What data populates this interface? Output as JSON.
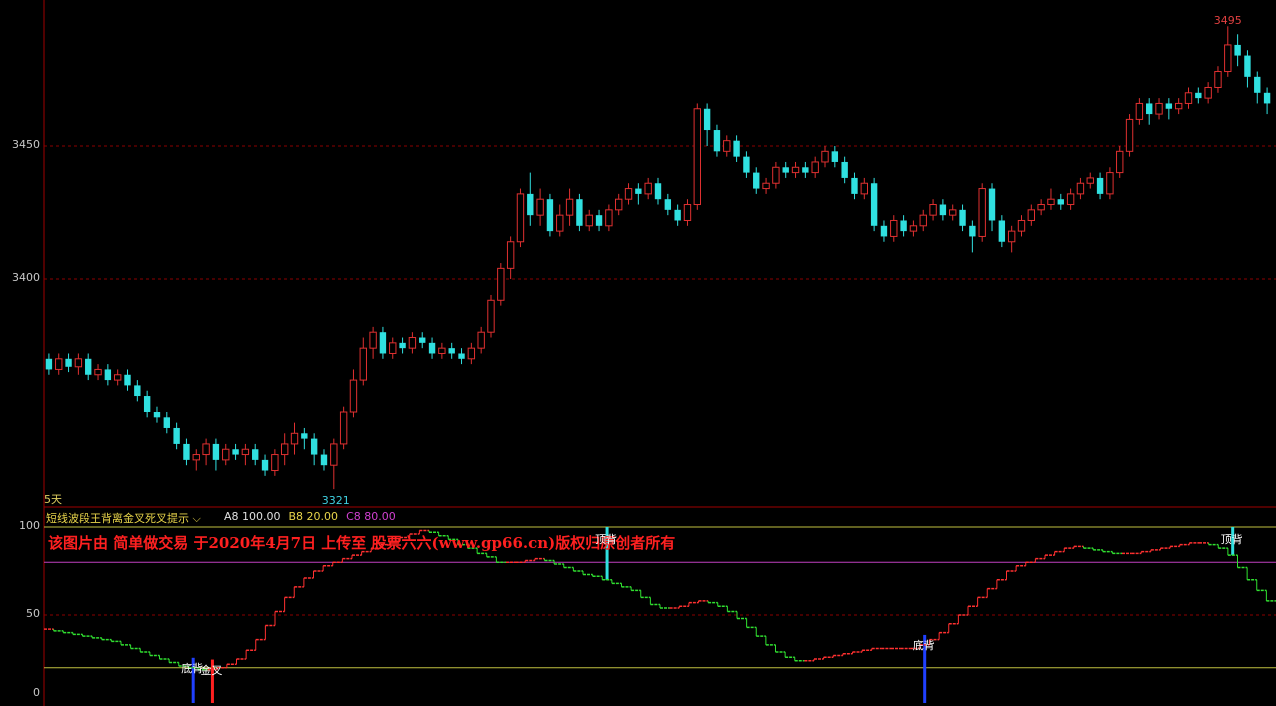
{
  "period_label": "5天",
  "indicator": {
    "title": "短线波段王背离金叉死叉提示",
    "dropdown_icon": "chevron-down-icon",
    "params": [
      {
        "name": "A8",
        "value": "100.00",
        "color": "#e0e0e0"
      },
      {
        "name": "B8",
        "value": "20.00",
        "color": "#e8d44a"
      },
      {
        "name": "C8",
        "value": "80.00",
        "color": "#d040d0"
      }
    ]
  },
  "watermark": "该图片由 简单做交易 于2020年4月7日 上传至 股票六六(www.gp66.cn)版权归原创者所有",
  "colors": {
    "up": "#e03030",
    "down": "#30e0e0",
    "grid": "#8b0000",
    "osc_up": "#ff3030",
    "osc_down": "#30e030"
  },
  "chart_data": [
    {
      "type": "candlestick",
      "y_ticks": [
        "3450",
        "3400"
      ],
      "ylim": [
        3321,
        3495
      ],
      "max_label": "3495",
      "min_label": "3321",
      "candles": [
        [
          3370,
          3366,
          3372,
          3364
        ],
        [
          3366,
          3370,
          3372,
          3364
        ],
        [
          3370,
          3367,
          3372,
          3365
        ],
        [
          3367,
          3370,
          3372,
          3364
        ],
        [
          3370,
          3364,
          3372,
          3362
        ],
        [
          3364,
          3366,
          3368,
          3362
        ],
        [
          3366,
          3362,
          3368,
          3360
        ],
        [
          3362,
          3364,
          3366,
          3360
        ],
        [
          3364,
          3360,
          3366,
          3358
        ],
        [
          3360,
          3356,
          3362,
          3354
        ],
        [
          3356,
          3350,
          3358,
          3348
        ],
        [
          3350,
          3348,
          3352,
          3346
        ],
        [
          3348,
          3344,
          3350,
          3342
        ],
        [
          3344,
          3338,
          3346,
          3336
        ],
        [
          3338,
          3332,
          3340,
          3330
        ],
        [
          3332,
          3334,
          3336,
          3328
        ],
        [
          3334,
          3338,
          3340,
          3330
        ],
        [
          3338,
          3332,
          3340,
          3328
        ],
        [
          3332,
          3336,
          3338,
          3330
        ],
        [
          3336,
          3334,
          3338,
          3332
        ],
        [
          3334,
          3336,
          3338,
          3330
        ],
        [
          3336,
          3332,
          3338,
          3330
        ],
        [
          3332,
          3328,
          3334,
          3326
        ],
        [
          3328,
          3334,
          3336,
          3326
        ],
        [
          3334,
          3338,
          3342,
          3330
        ],
        [
          3338,
          3342,
          3346,
          3334
        ],
        [
          3342,
          3340,
          3344,
          3336
        ],
        [
          3340,
          3334,
          3342,
          3330
        ],
        [
          3334,
          3330,
          3336,
          3328
        ],
        [
          3330,
          3338,
          3340,
          3321
        ],
        [
          3338,
          3350,
          3352,
          3336
        ],
        [
          3350,
          3362,
          3366,
          3348
        ],
        [
          3362,
          3374,
          3378,
          3360
        ],
        [
          3374,
          3380,
          3382,
          3370
        ],
        [
          3380,
          3372,
          3382,
          3370
        ],
        [
          3372,
          3376,
          3378,
          3370
        ],
        [
          3376,
          3374,
          3378,
          3372
        ],
        [
          3374,
          3378,
          3380,
          3372
        ],
        [
          3378,
          3376,
          3380,
          3374
        ],
        [
          3376,
          3372,
          3378,
          3370
        ],
        [
          3372,
          3374,
          3376,
          3370
        ],
        [
          3374,
          3372,
          3376,
          3370
        ],
        [
          3372,
          3370,
          3374,
          3368
        ],
        [
          3370,
          3374,
          3376,
          3368
        ],
        [
          3374,
          3380,
          3382,
          3372
        ],
        [
          3380,
          3392,
          3394,
          3378
        ],
        [
          3392,
          3404,
          3406,
          3390
        ],
        [
          3404,
          3414,
          3416,
          3400
        ],
        [
          3414,
          3432,
          3434,
          3412
        ],
        [
          3432,
          3424,
          3440,
          3420
        ],
        [
          3424,
          3430,
          3434,
          3420
        ],
        [
          3430,
          3418,
          3432,
          3416
        ],
        [
          3418,
          3424,
          3428,
          3416
        ],
        [
          3424,
          3430,
          3434,
          3420
        ],
        [
          3430,
          3420,
          3432,
          3418
        ],
        [
          3420,
          3424,
          3426,
          3418
        ],
        [
          3424,
          3420,
          3426,
          3418
        ],
        [
          3420,
          3426,
          3428,
          3418
        ],
        [
          3426,
          3430,
          3432,
          3424
        ],
        [
          3430,
          3434,
          3436,
          3428
        ],
        [
          3434,
          3432,
          3436,
          3428
        ],
        [
          3432,
          3436,
          3438,
          3430
        ],
        [
          3436,
          3430,
          3438,
          3428
        ],
        [
          3430,
          3426,
          3432,
          3424
        ],
        [
          3426,
          3422,
          3428,
          3420
        ],
        [
          3422,
          3428,
          3430,
          3420
        ],
        [
          3428,
          3464,
          3466,
          3426
        ],
        [
          3464,
          3456,
          3466,
          3450
        ],
        [
          3456,
          3448,
          3458,
          3446
        ],
        [
          3448,
          3452,
          3454,
          3446
        ],
        [
          3452,
          3446,
          3454,
          3444
        ],
        [
          3446,
          3440,
          3448,
          3438
        ],
        [
          3440,
          3434,
          3442,
          3432
        ],
        [
          3434,
          3436,
          3438,
          3432
        ],
        [
          3436,
          3442,
          3444,
          3434
        ],
        [
          3442,
          3440,
          3444,
          3438
        ],
        [
          3440,
          3442,
          3444,
          3438
        ],
        [
          3442,
          3440,
          3444,
          3438
        ],
        [
          3440,
          3444,
          3446,
          3438
        ],
        [
          3444,
          3448,
          3450,
          3442
        ],
        [
          3448,
          3444,
          3450,
          3442
        ],
        [
          3444,
          3438,
          3446,
          3436
        ],
        [
          3438,
          3432,
          3440,
          3430
        ],
        [
          3432,
          3436,
          3438,
          3430
        ],
        [
          3436,
          3420,
          3438,
          3418
        ],
        [
          3420,
          3416,
          3422,
          3414
        ],
        [
          3416,
          3422,
          3424,
          3414
        ],
        [
          3422,
          3418,
          3424,
          3416
        ],
        [
          3418,
          3420,
          3422,
          3416
        ],
        [
          3420,
          3424,
          3426,
          3418
        ],
        [
          3424,
          3428,
          3430,
          3422
        ],
        [
          3428,
          3424,
          3430,
          3422
        ],
        [
          3424,
          3426,
          3428,
          3422
        ],
        [
          3426,
          3420,
          3428,
          3418
        ],
        [
          3420,
          3416,
          3422,
          3410
        ],
        [
          3416,
          3434,
          3436,
          3414
        ],
        [
          3434,
          3422,
          3436,
          3418
        ],
        [
          3422,
          3414,
          3424,
          3412
        ],
        [
          3414,
          3418,
          3420,
          3410
        ],
        [
          3418,
          3422,
          3424,
          3416
        ],
        [
          3422,
          3426,
          3428,
          3420
        ],
        [
          3426,
          3428,
          3430,
          3424
        ],
        [
          3428,
          3430,
          3434,
          3426
        ],
        [
          3430,
          3428,
          3432,
          3426
        ],
        [
          3428,
          3432,
          3434,
          3426
        ],
        [
          3432,
          3436,
          3438,
          3430
        ],
        [
          3436,
          3438,
          3440,
          3434
        ],
        [
          3438,
          3432,
          3440,
          3430
        ],
        [
          3432,
          3440,
          3442,
          3430
        ],
        [
          3440,
          3448,
          3450,
          3438
        ],
        [
          3448,
          3460,
          3462,
          3446
        ],
        [
          3460,
          3466,
          3468,
          3458
        ],
        [
          3466,
          3462,
          3468,
          3458
        ],
        [
          3462,
          3466,
          3468,
          3460
        ],
        [
          3466,
          3464,
          3468,
          3460
        ],
        [
          3464,
          3466,
          3468,
          3462
        ],
        [
          3466,
          3470,
          3472,
          3464
        ],
        [
          3470,
          3468,
          3472,
          3466
        ],
        [
          3468,
          3472,
          3474,
          3466
        ],
        [
          3472,
          3478,
          3480,
          3470
        ],
        [
          3478,
          3488,
          3495,
          3476
        ],
        [
          3488,
          3484,
          3492,
          3480
        ],
        [
          3484,
          3476,
          3486,
          3472
        ],
        [
          3476,
          3470,
          3478,
          3466
        ],
        [
          3470,
          3466,
          3472,
          3462
        ]
      ]
    },
    {
      "type": "line",
      "y_ticks": [
        "100",
        "50",
        "0"
      ],
      "ylim": [
        0,
        100
      ],
      "reference_lines": [
        100,
        80,
        50,
        20
      ],
      "labels": [
        {
          "text": "底背",
          "index": 15,
          "color": "#ffffff",
          "bar_color": "#2040ff"
        },
        {
          "text": "金叉",
          "index": 17,
          "color": "#ffffff",
          "bar_color": "#ff2020"
        },
        {
          "text": "顶背",
          "index": 58,
          "color": "#ffffff",
          "bar_color": "#30e0e0"
        },
        {
          "text": "底背",
          "index": 91,
          "color": "#ffffff",
          "bar_color": "#2040ff"
        },
        {
          "text": "顶背",
          "index": 123,
          "color": "#ffffff",
          "bar_color": "#30e0e0"
        }
      ],
      "values": [
        42,
        41,
        40,
        39,
        38,
        37,
        36,
        35,
        33,
        31,
        29,
        27,
        25,
        23,
        21,
        20,
        19,
        19,
        20,
        22,
        25,
        30,
        36,
        44,
        52,
        60,
        66,
        71,
        75,
        78,
        80,
        82,
        84,
        86,
        88,
        90,
        92,
        94,
        96,
        98,
        97,
        95,
        93,
        90,
        88,
        85,
        83,
        80,
        80,
        80,
        81,
        82,
        81,
        79,
        77,
        75,
        73,
        72,
        70,
        68,
        66,
        64,
        60,
        56,
        54,
        54,
        55,
        57,
        58,
        57,
        55,
        52,
        48,
        43,
        38,
        33,
        29,
        26,
        24,
        24,
        25,
        26,
        27,
        28,
        29,
        30,
        31,
        31,
        31,
        31,
        31,
        33,
        36,
        40,
        45,
        50,
        55,
        60,
        65,
        70,
        75,
        78,
        80,
        82,
        84,
        86,
        88,
        89,
        88,
        87,
        86,
        85,
        85,
        85,
        86,
        87,
        88,
        89,
        90,
        91,
        91,
        90,
        88,
        84,
        77,
        70,
        64,
        58
      ]
    }
  ]
}
